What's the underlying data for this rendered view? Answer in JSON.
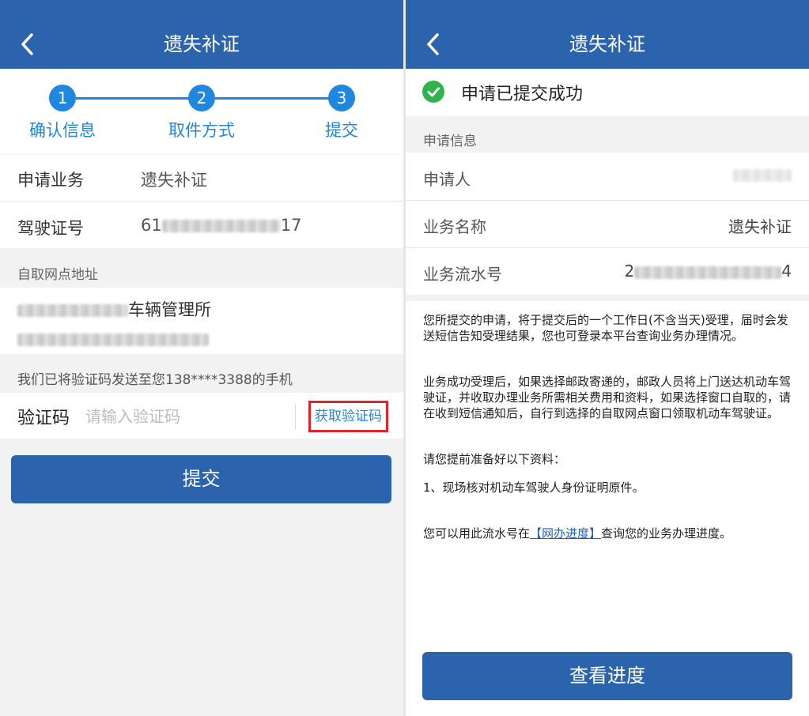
{
  "left": {
    "header": {
      "title": "遗失补证"
    },
    "steps": [
      {
        "number": "1",
        "label": "确认信息"
      },
      {
        "number": "2",
        "label": "取件方式"
      },
      {
        "number": "3",
        "label": "提交"
      }
    ],
    "fields": {
      "business_label": "申请业务",
      "business_value": "遗失补证",
      "license_label": "驾驶证号",
      "license_prefix": "61",
      "license_suffix": "17"
    },
    "pickup": {
      "section_title": "自取网点地址",
      "office_name": "车辆管理所"
    },
    "sms_notice": "我们已将验证码发送至您138****3388的手机",
    "verify": {
      "label": "验证码",
      "placeholder": "请输入验证码",
      "get_code_label": "获取验证码"
    },
    "submit_label": "提交"
  },
  "right": {
    "header": {
      "title": "遗失补证"
    },
    "success_text": "申请已提交成功",
    "section_title": "申请信息",
    "rows": {
      "applicant_label": "申请人",
      "business_label": "业务名称",
      "business_value": "遗失补证",
      "serial_label": "业务流水号",
      "serial_prefix": "2",
      "serial_suffix": "4"
    },
    "notice": {
      "p1": "您所提交的申请，将于提交后的一个工作日(不含当天)受理，届时会发送短信告知受理结果，您也可登录本平台查询业务办理情况。",
      "p2": "业务成功受理后，如果选择邮政寄递的，邮政人员将上门送达机动车驾驶证，并收取办理业务所需相关费用和资料，如果选择窗口自取的，请在收到短信通知后，自行到选择的自取网点窗口领取机动车驾驶证。",
      "p3": "请您提前准备好以下资料：",
      "p4": "1、现场核对机动车驾驶人身份证明原件。",
      "p5_before": "您可以用此流水号在",
      "p5_link": "【网办进度】",
      "p5_after": "查询您的业务办理进度。"
    },
    "view_progress_label": "查看进度"
  },
  "colors": {
    "header_blue": "#2c63ad",
    "step_blue": "#1f87e0",
    "highlight_red": "#e0242c",
    "success_green": "#2fb34a"
  }
}
